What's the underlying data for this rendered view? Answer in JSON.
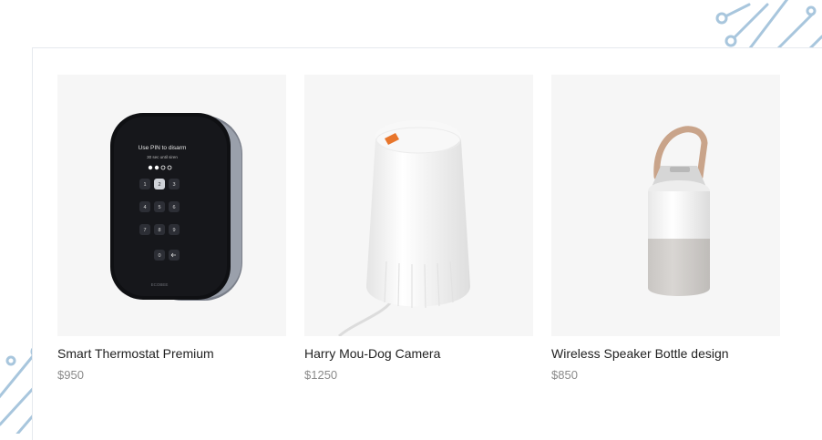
{
  "products": [
    {
      "name": "Smart Thermostat Premium",
      "price": "$950",
      "image": "smart-thermostat-image",
      "screen_text": {
        "line1": "Use PIN to disarm",
        "line2": "30 sec until siren",
        "keys": [
          "1",
          "2",
          "3",
          "4",
          "5",
          "6",
          "7",
          "8",
          "9",
          "0"
        ],
        "brand": "ECOBEE"
      }
    },
    {
      "name": "Harry Mou-Dog Camera",
      "price": "$1250",
      "image": "dog-camera-image"
    },
    {
      "name": "Wireless Speaker Bottle design",
      "price": "$850",
      "image": "bottle-speaker-image"
    }
  ],
  "colors": {
    "card_background": "#f6f6f6",
    "price_text": "#8a8a8a",
    "name_text": "#222222",
    "circuit_decoration": "#a8c6dd"
  }
}
